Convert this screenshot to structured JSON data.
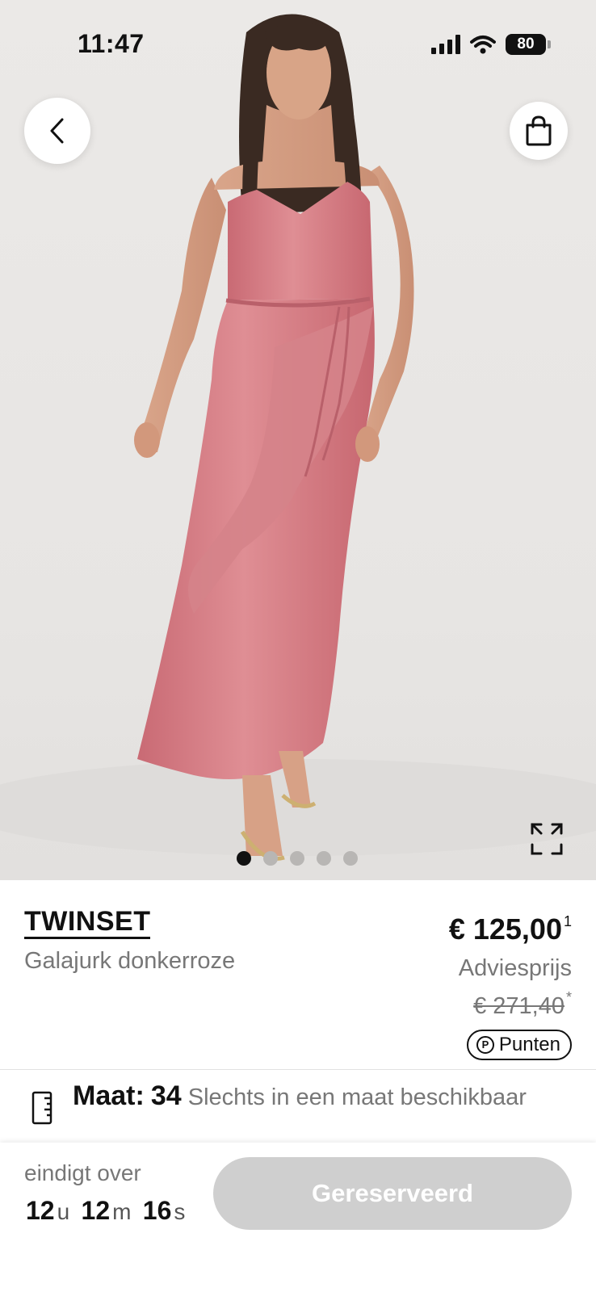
{
  "status_bar": {
    "time": "11:47",
    "battery": "80"
  },
  "gallery": {
    "image_count": 5,
    "active_index": 0,
    "image_alt": "Model in pink satin maxi dress"
  },
  "product": {
    "brand": "TWINSET",
    "name": "Galajurk donkerroze",
    "price": "€ 125,00",
    "price_footnote": "1",
    "advice_label": "Adviesprijs",
    "advice_price": "€ 271,40",
    "advice_footnote": "*",
    "points_label": "Punten",
    "points_icon_letter": "P"
  },
  "size": {
    "label": "Maat:",
    "value": "34",
    "note": "Slechts in een maat beschikbaar"
  },
  "footer": {
    "ends_label": "eindigt over",
    "hours": "12",
    "hours_unit": "u",
    "minutes": "12",
    "minutes_unit": "m",
    "seconds": "16",
    "seconds_unit": "s",
    "button_label": "Gereserveerd"
  },
  "colors": {
    "dress": "#d47c84",
    "button_disabled": "#cfcfcf",
    "text_muted": "#777777"
  },
  "icons": [
    "back-chevron-icon",
    "shopping-bag-icon",
    "expand-icon",
    "ruler-icon",
    "signal-icon",
    "wifi-icon",
    "battery-icon",
    "points-icon"
  ]
}
